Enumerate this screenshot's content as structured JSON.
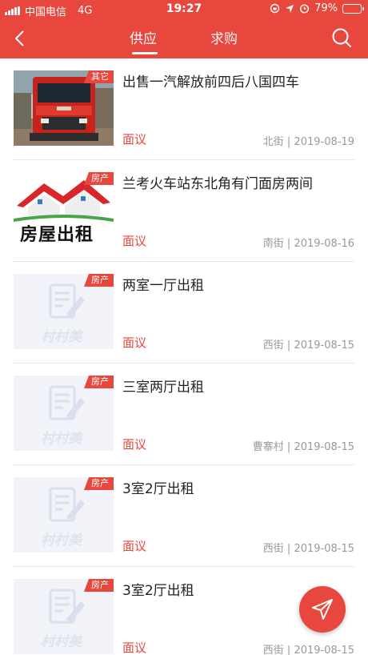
{
  "statusbar": {
    "carrier": "中国电信",
    "network": "4G",
    "time": "19:27",
    "battery_text": "79%",
    "battery_level": 0.79
  },
  "nav": {
    "tabs": [
      {
        "label": "供应",
        "active": true
      },
      {
        "label": "求购",
        "active": false
      }
    ]
  },
  "listings": [
    {
      "title": "出售一汽解放前四后八国四车",
      "tag": "其它",
      "price": "面议",
      "meta": "北街 | 2019-08-19",
      "image": "truck-photo"
    },
    {
      "title": "兰考火车站东北角有门面房两间",
      "tag": "房产",
      "price": "面议",
      "meta": "南街 | 2019-08-16",
      "image": "house-rent-banner",
      "banner_text": "房屋出租"
    },
    {
      "title": "两室一厅出租",
      "tag": "房产",
      "price": "面议",
      "meta": "西街 | 2019-08-15",
      "image": "placeholder",
      "watermark": "村村美"
    },
    {
      "title": "三室两厅出租",
      "tag": "房产",
      "price": "面议",
      "meta": "曹寨村 | 2019-08-15",
      "image": "placeholder",
      "watermark": "村村美"
    },
    {
      "title": "3室2厅出租",
      "tag": "房产",
      "price": "面议",
      "meta": "西街 | 2019-08-15",
      "image": "placeholder",
      "watermark": "村村美"
    },
    {
      "title": "3室2厅出租",
      "tag": "房产",
      "price": "面议",
      "meta": "西街 | 2019-08-15",
      "image": "placeholder",
      "watermark": "村村美"
    }
  ],
  "colors": {
    "accent": "#e8473d",
    "text": "#222222",
    "muted": "#999999"
  }
}
